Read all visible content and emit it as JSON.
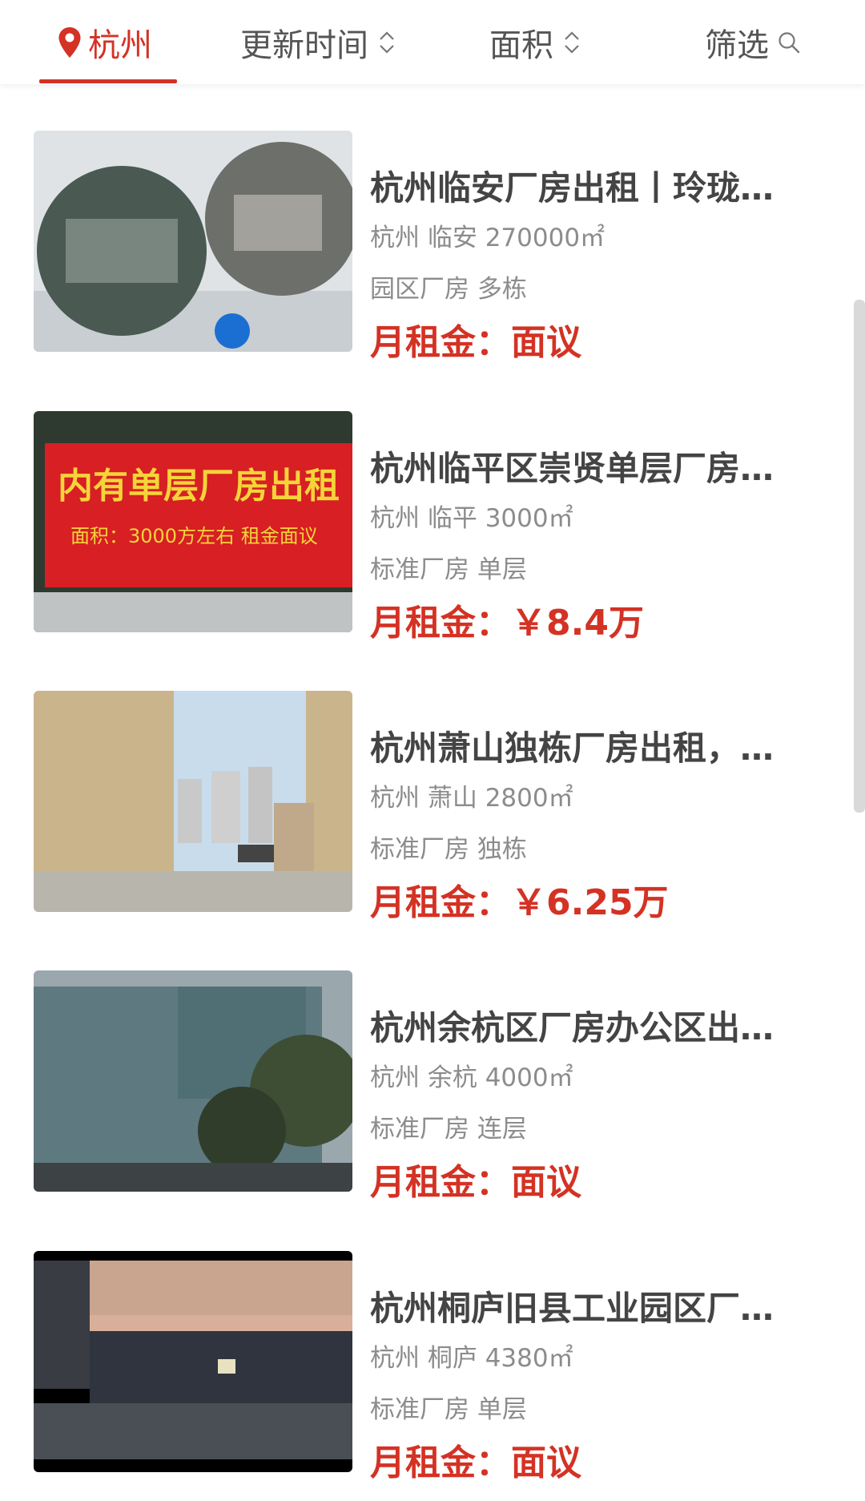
{
  "header": {
    "city": "杭州",
    "sort_update": "更新时间",
    "sort_area": "面积",
    "filter": "筛选"
  },
  "colors": {
    "accent": "#d43224",
    "text": "#444444",
    "muted": "#8c8c8c"
  },
  "listings": [
    {
      "title": "杭州临安厂房出租丨玲珑…",
      "location": "杭州 临安 270000㎡",
      "tags": "园区厂房 多栋",
      "price_label": "月租金：",
      "price_value": "面议"
    },
    {
      "title": "杭州临平区崇贤单层厂房…",
      "location": "杭州 临平 3000㎡",
      "tags": "标准厂房 单层",
      "price_label": "月租金：",
      "price_value": "￥8.4万",
      "banner_line1": "内有单层厂房出租",
      "banner_line2": "面积：3000方左右  租金面议"
    },
    {
      "title": "杭州萧山独栋厂房出租，…",
      "location": "杭州 萧山 2800㎡",
      "tags": "标准厂房 独栋",
      "price_label": "月租金：",
      "price_value": "￥6.25万"
    },
    {
      "title": "杭州余杭区厂房办公区出…",
      "location": "杭州 余杭 4000㎡",
      "tags": "标准厂房 连层",
      "price_label": "月租金：",
      "price_value": "面议"
    },
    {
      "title": "杭州桐庐旧县工业园区厂…",
      "location": "杭州 桐庐 4380㎡",
      "tags": "标准厂房 单层",
      "price_label": "月租金：",
      "price_value": "面议"
    }
  ]
}
